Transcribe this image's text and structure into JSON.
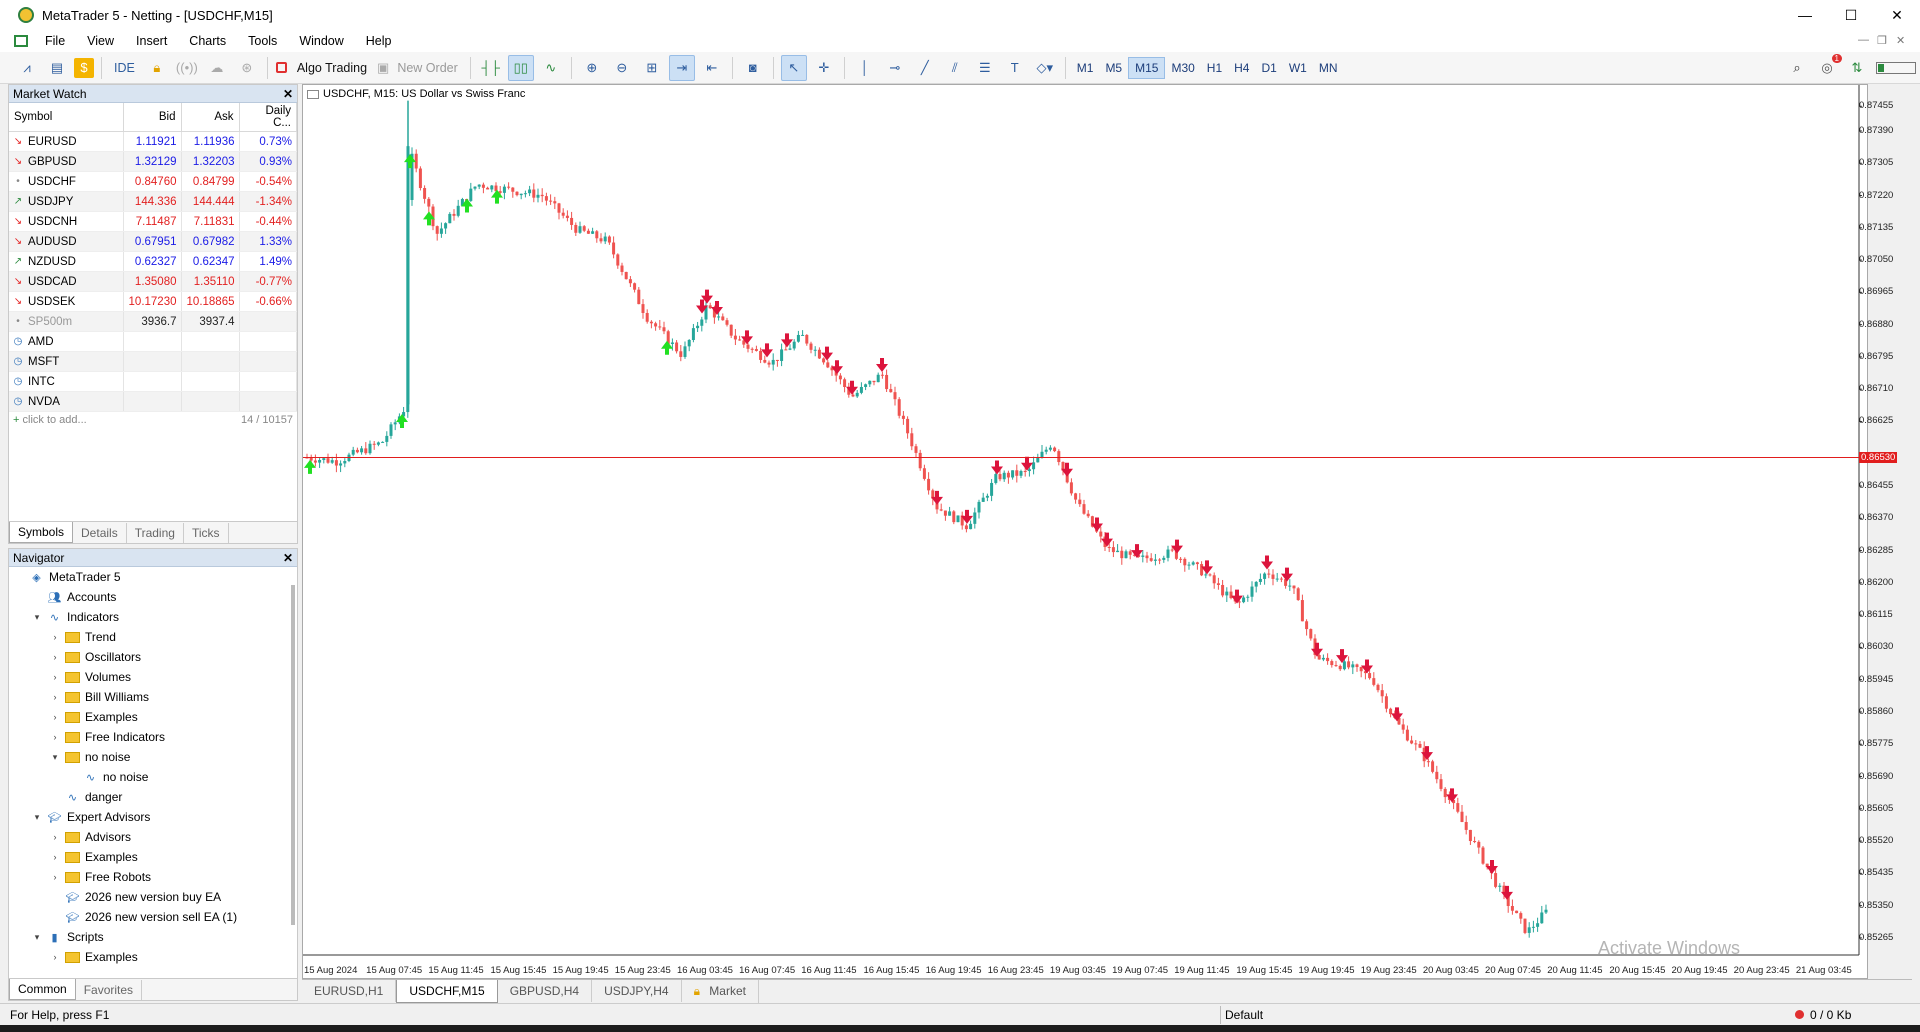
{
  "window": {
    "title": "MetaTrader 5 - Netting - [USDCHF,M15]",
    "minimize": "—",
    "maximize": "☐",
    "close": "✕"
  },
  "menu": [
    "File",
    "View",
    "Insert",
    "Charts",
    "Tools",
    "Window",
    "Help"
  ],
  "toolbar": {
    "ide_label": "IDE",
    "algo_trading_label": "Algo Trading",
    "new_order_label": "New Order",
    "timeframes": [
      "M1",
      "M5",
      "M15",
      "M30",
      "H1",
      "H4",
      "D1",
      "W1",
      "MN"
    ],
    "active_timeframe": "M15",
    "notification_count": "1"
  },
  "market_watch": {
    "title": "Market Watch",
    "columns": [
      "Symbol",
      "Bid",
      "Ask",
      "Daily C..."
    ],
    "rows": [
      {
        "symbol": "EURUSD",
        "bid": "1.11921",
        "ask": "1.11936",
        "change": "0.73%",
        "dir": "down",
        "color": "#1a1ae6"
      },
      {
        "symbol": "GBPUSD",
        "bid": "1.32129",
        "ask": "1.32203",
        "change": "0.93%",
        "dir": "down",
        "color": "#1a1ae6"
      },
      {
        "symbol": "USDCHF",
        "bid": "0.84760",
        "ask": "0.84799",
        "change": "-0.54%",
        "dir": "dot",
        "color": "#e22020"
      },
      {
        "symbol": "USDJPY",
        "bid": "144.336",
        "ask": "144.444",
        "change": "-1.34%",
        "dir": "up",
        "color": "#e22020"
      },
      {
        "symbol": "USDCNH",
        "bid": "7.11487",
        "ask": "7.11831",
        "change": "-0.44%",
        "dir": "down",
        "color": "#e22020"
      },
      {
        "symbol": "AUDUSD",
        "bid": "0.67951",
        "ask": "0.67982",
        "change": "1.33%",
        "dir": "down",
        "color": "#1a1ae6"
      },
      {
        "symbol": "NZDUSD",
        "bid": "0.62327",
        "ask": "0.62347",
        "change": "1.49%",
        "dir": "up",
        "color": "#1a1ae6"
      },
      {
        "symbol": "USDCAD",
        "bid": "1.35080",
        "ask": "1.35110",
        "change": "-0.77%",
        "dir": "down",
        "color": "#e22020"
      },
      {
        "symbol": "USDSEK",
        "bid": "10.17230",
        "ask": "10.18865",
        "change": "-0.66%",
        "dir": "down",
        "color": "#e22020"
      },
      {
        "symbol": "SP500m",
        "bid": "3936.7",
        "ask": "3937.4",
        "change": "",
        "dir": "dot",
        "color": "#222222"
      },
      {
        "symbol": "AMD",
        "bid": "",
        "ask": "",
        "change": "",
        "dir": "clock",
        "color": "#222222"
      },
      {
        "symbol": "MSFT",
        "bid": "",
        "ask": "",
        "change": "",
        "dir": "clock",
        "color": "#222222"
      },
      {
        "symbol": "INTC",
        "bid": "",
        "ask": "",
        "change": "",
        "dir": "clock",
        "color": "#222222"
      },
      {
        "symbol": "NVDA",
        "bid": "",
        "ask": "",
        "change": "",
        "dir": "clock",
        "color": "#222222"
      }
    ],
    "add_label": "click to add...",
    "count": "14 / 10157",
    "tabs": [
      "Symbols",
      "Details",
      "Trading",
      "Ticks"
    ]
  },
  "navigator": {
    "title": "Navigator",
    "items": [
      {
        "label": "MetaTrader 5",
        "level": 0,
        "toggle": "",
        "icon": "mt5-icon"
      },
      {
        "label": "Accounts",
        "level": 1,
        "toggle": "",
        "icon": "accounts-icon"
      },
      {
        "label": "Indicators",
        "level": 1,
        "toggle": "▾",
        "icon": "indicators-icon"
      },
      {
        "label": "Trend",
        "level": 2,
        "toggle": "›",
        "icon": "folder"
      },
      {
        "label": "Oscillators",
        "level": 2,
        "toggle": "›",
        "icon": "folder"
      },
      {
        "label": "Volumes",
        "level": 2,
        "toggle": "›",
        "icon": "folder"
      },
      {
        "label": "Bill Williams",
        "level": 2,
        "toggle": "›",
        "icon": "folder"
      },
      {
        "label": "Examples",
        "level": 2,
        "toggle": "›",
        "icon": "folder"
      },
      {
        "label": "Free Indicators",
        "level": 2,
        "toggle": "›",
        "icon": "folder"
      },
      {
        "label": "no noise",
        "level": 2,
        "toggle": "▾",
        "icon": "folder"
      },
      {
        "label": "no noise",
        "level": 3,
        "toggle": "",
        "icon": "indicator-file-icon"
      },
      {
        "label": "danger",
        "level": 2,
        "toggle": "",
        "icon": "indicator-file-icon"
      },
      {
        "label": "Expert Advisors",
        "level": 1,
        "toggle": "▾",
        "icon": "expert-icon"
      },
      {
        "label": "Advisors",
        "level": 2,
        "toggle": "›",
        "icon": "folder"
      },
      {
        "label": "Examples",
        "level": 2,
        "toggle": "›",
        "icon": "folder"
      },
      {
        "label": "Free Robots",
        "level": 2,
        "toggle": "›",
        "icon": "folder"
      },
      {
        "label": "2026 new version buy EA",
        "level": 2,
        "toggle": "",
        "icon": "expert-icon"
      },
      {
        "label": "2026 new version sell EA (1)",
        "level": 2,
        "toggle": "",
        "icon": "expert-icon"
      },
      {
        "label": "Scripts",
        "level": 1,
        "toggle": "▾",
        "icon": "scripts-icon"
      },
      {
        "label": "Examples",
        "level": 2,
        "toggle": "›",
        "icon": "folder"
      }
    ],
    "tabs": [
      "Common",
      "Favorites"
    ]
  },
  "chart": {
    "legend": "USDCHF, M15:  US Dollar vs Swiss Franc",
    "current_price": "0.86530",
    "price_line_color": "#e11d1d",
    "price_labels": [
      "0.87455",
      "0.87390",
      "0.87305",
      "0.87220",
      "0.87135",
      "0.87050",
      "0.86965",
      "0.86880",
      "0.86795",
      "0.86710",
      "0.86625",
      "0.86455",
      "0.86370",
      "0.86285",
      "0.86200",
      "0.86115",
      "0.86030",
      "0.85945",
      "0.85860",
      "0.85775",
      "0.85690",
      "0.85605",
      "0.85520",
      "0.85435",
      "0.85350",
      "0.85265"
    ],
    "time_labels": [
      "15 Aug 2024",
      "15 Aug 07:45",
      "15 Aug 11:45",
      "15 Aug 15:45",
      "15 Aug 19:45",
      "15 Aug 23:45",
      "16 Aug 03:45",
      "16 Aug 07:45",
      "16 Aug 11:45",
      "16 Aug 15:45",
      "16 Aug 19:45",
      "16 Aug 23:45",
      "19 Aug 03:45",
      "19 Aug 07:45",
      "19 Aug 11:45",
      "19 Aug 15:45",
      "19 Aug 19:45",
      "19 Aug 23:45",
      "20 Aug 03:45",
      "20 Aug 07:45",
      "20 Aug 11:45",
      "20 Aug 15:45",
      "20 Aug 19:45",
      "20 Aug 23:45",
      "21 Aug 03:45"
    ],
    "bull_color": "#26a69a",
    "bear_color": "#ef5350",
    "buy_arrow_color": "#22e022",
    "sell_arrow_color": "#dc143c"
  },
  "chart_data": {
    "type": "candlestick",
    "symbol": "USDCHF",
    "timeframe": "M15",
    "title": "USDCHF, M15: US Dollar vs Swiss Franc",
    "ylim": [
      0.8522,
      0.8749
    ],
    "x_start": "15 Aug 2024",
    "x_end": "21 Aug 03:45",
    "path": [
      [
        0,
        0.8653
      ],
      [
        30,
        0.8652
      ],
      [
        75,
        0.8657
      ],
      [
        100,
        0.8667
      ],
      [
        101,
        0.8735
      ],
      [
        130,
        0.8712
      ],
      [
        170,
        0.8725
      ],
      [
        235,
        0.8722
      ],
      [
        270,
        0.8713
      ],
      [
        300,
        0.871
      ],
      [
        340,
        0.869
      ],
      [
        375,
        0.868
      ],
      [
        400,
        0.8693
      ],
      [
        430,
        0.8684
      ],
      [
        465,
        0.8678
      ],
      [
        495,
        0.8685
      ],
      [
        520,
        0.8678
      ],
      [
        545,
        0.8669
      ],
      [
        575,
        0.8675
      ],
      [
        600,
        0.866
      ],
      [
        630,
        0.864
      ],
      [
        660,
        0.8635
      ],
      [
        690,
        0.8648
      ],
      [
        720,
        0.8649
      ],
      [
        745,
        0.8657
      ],
      [
        770,
        0.8641
      ],
      [
        800,
        0.8629
      ],
      [
        830,
        0.8626
      ],
      [
        865,
        0.8628
      ],
      [
        895,
        0.8623
      ],
      [
        930,
        0.8614
      ],
      [
        960,
        0.8623
      ],
      [
        985,
        0.8619
      ],
      [
        1010,
        0.86
      ],
      [
        1040,
        0.8598
      ],
      [
        1065,
        0.8595
      ],
      [
        1090,
        0.8583
      ],
      [
        1115,
        0.8575
      ],
      [
        1140,
        0.8564
      ],
      [
        1170,
        0.855
      ],
      [
        1195,
        0.8538
      ],
      [
        1220,
        0.8528
      ],
      [
        1245,
        0.8535
      ]
    ],
    "buy_signals": [
      3,
      95,
      103,
      122,
      160,
      190,
      360
    ],
    "sell_signals": [
      395,
      400,
      410,
      440,
      460,
      480,
      520,
      530,
      545,
      575,
      630,
      660,
      690,
      720,
      760,
      790,
      800,
      830,
      870,
      900,
      930,
      960,
      980,
      1010,
      1035,
      1060,
      1090,
      1120,
      1145,
      1185,
      1200
    ]
  },
  "chart_tabs": [
    "EURUSD,H1",
    "USDCHF,M15",
    "GBPUSD,H4",
    "USDJPY,H4",
    "Market"
  ],
  "active_chart_tab": "USDCHF,M15",
  "status": {
    "help": "For Help, press F1",
    "profile": "Default",
    "traffic": "0 / 0 Kb"
  },
  "watermark": "Activate Windows"
}
